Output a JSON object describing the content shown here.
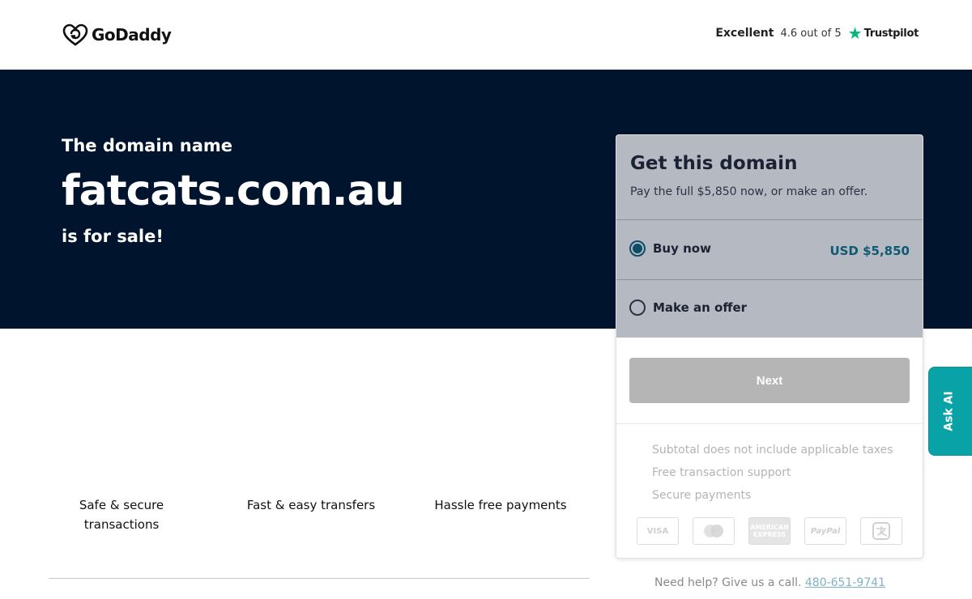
{
  "header": {
    "logo_text": "GoDaddy",
    "trustpilot": {
      "rating_word": "Excellent",
      "score_text": "4.6 out of 5",
      "brand": "Trustpilot",
      "star_color": "#00b67a"
    }
  },
  "hero": {
    "intro": "The domain name",
    "domain": "fatcats.com.au",
    "suffix": "is for sale!",
    "background": "#00142e"
  },
  "card": {
    "title": "Get this domain",
    "subtitle": "Pay the full $5,850 now, or make an offer.",
    "options": [
      {
        "label": "Buy now",
        "price": "USD $5,850",
        "selected": true
      },
      {
        "label": "Make an offer",
        "selected": false
      }
    ],
    "next_label": "Next",
    "info": [
      "Subtotal does not include applicable taxes",
      "Free transaction support",
      "Secure payments"
    ],
    "payment_methods": [
      "VISA",
      "mastercard",
      "AMERICAN EXPRESS",
      "PayPal",
      "alipay"
    ]
  },
  "features": [
    "Safe & secure transactions",
    "Fast & easy transfers",
    "Hassle free payments"
  ],
  "help": {
    "text": "Need help? Give us a call.",
    "phone": "480-651-9741"
  },
  "ask_ai": {
    "label": "Ask AI",
    "color": "#09a3a7"
  }
}
